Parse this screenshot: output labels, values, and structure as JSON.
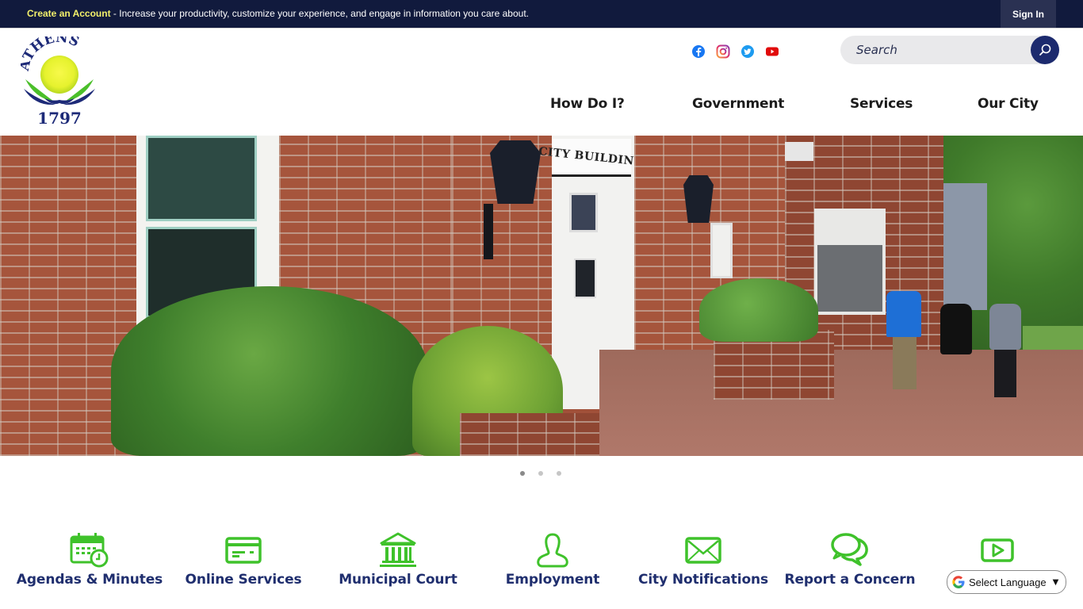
{
  "topbar": {
    "create_account": "Create an Account",
    "promo_text": " - Increase your productivity, customize your experience, and engage in information you care about.",
    "sign_in": "Sign In"
  },
  "header": {
    "logo_text_top": "ATHENS",
    "logo_text_year": "1797",
    "social": [
      "facebook-icon",
      "instagram-icon",
      "twitter-icon",
      "youtube-icon"
    ],
    "search_placeholder": "Search"
  },
  "nav": {
    "items": [
      {
        "label": "How Do I?"
      },
      {
        "label": "Government"
      },
      {
        "label": "Services"
      },
      {
        "label": "Our City"
      }
    ]
  },
  "hero": {
    "sign_text": "CITY BUILDING",
    "slide_count": 3,
    "active_slide": 1
  },
  "quick_links": [
    {
      "label": "Agendas & Minutes",
      "icon": "calendar-clock-icon"
    },
    {
      "label": "Online Services",
      "icon": "credit-card-icon"
    },
    {
      "label": "Municipal Court",
      "icon": "courthouse-icon"
    },
    {
      "label": "Employment",
      "icon": "person-icon"
    },
    {
      "label": "City Notifications",
      "icon": "envelope-icon"
    },
    {
      "label": "Report a Concern",
      "icon": "chat-bubbles-icon"
    },
    {
      "label": "",
      "icon": "video-play-icon"
    }
  ],
  "language": {
    "selected": "Select Language"
  },
  "colors": {
    "topbar_bg": "#111a3d",
    "accent_yellow": "#f3f06b",
    "navy": "#1f2e6e",
    "icon_green": "#3fc22b"
  }
}
